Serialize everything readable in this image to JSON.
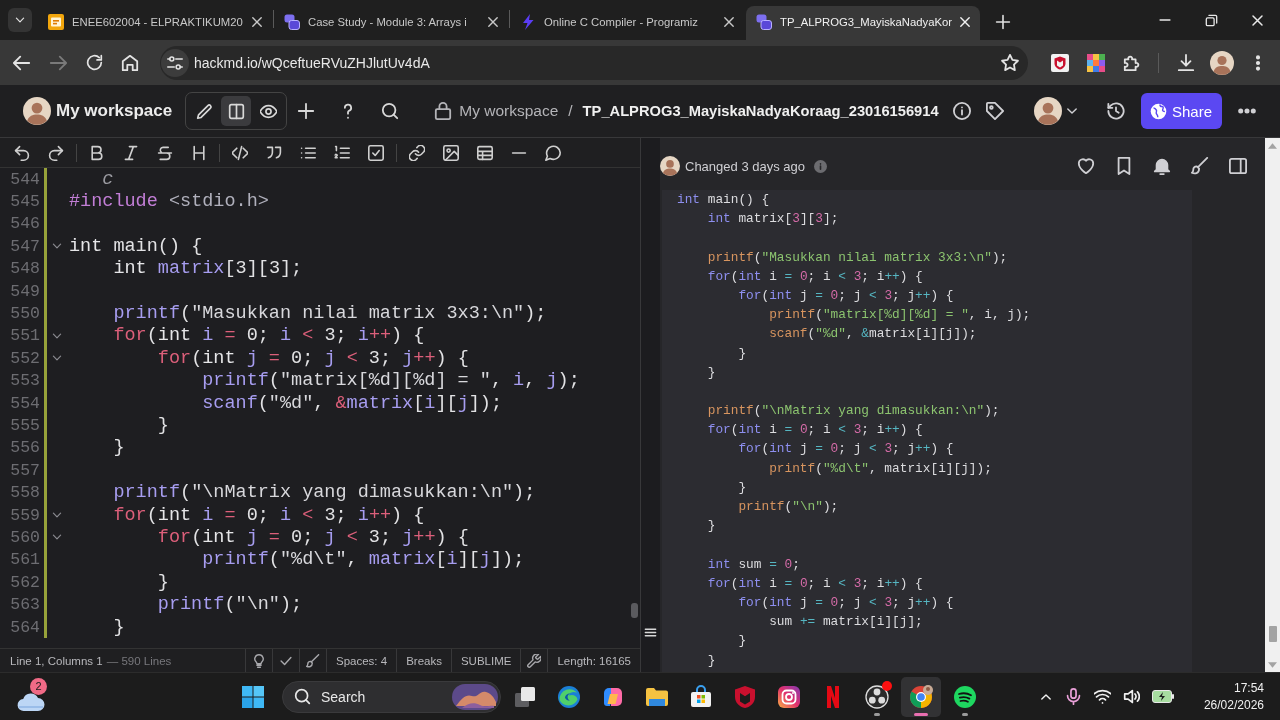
{
  "browser": {
    "tabs": [
      {
        "kind": "docs",
        "title": "ENEE602004 - ELPRAKTIKUM20",
        "selected": false
      },
      {
        "kind": "notes",
        "title": "Case Study - Module 3: Arrays i",
        "selected": false
      },
      {
        "kind": "compiler",
        "title": "Online C Compiler - Programiz",
        "selected": false
      },
      {
        "kind": "notes",
        "title": "TP_ALPROG3_MayiskaNadyaKor",
        "selected": true
      }
    ],
    "url": "hackmd.io/wQceftueRVuZHJlutUv4dA"
  },
  "header": {
    "workspace": "My workspace",
    "modes": [
      {
        "kind": "edit",
        "selected": false
      },
      {
        "kind": "split",
        "selected": true
      },
      {
        "kind": "view",
        "selected": false
      }
    ],
    "breadcrumb": {
      "parent": "My workspace",
      "separator": "/",
      "title": "TP_ALPROG3_MayiskaNadyaKoraag_23016156914"
    },
    "share": "Share"
  },
  "editor": {
    "block_marker": true,
    "lines": [
      {
        "number": "544",
        "kind": "code",
        "fold": false,
        "tokens": [
          {
            "kind": "fence",
            "text": "   c"
          }
        ]
      },
      {
        "number": "545",
        "kind": "code",
        "fold": false,
        "tokens": [
          {
            "kind": "directive",
            "text": "#include"
          },
          {
            "kind": "header",
            "text": " <stdio.h>"
          }
        ]
      },
      {
        "number": "546",
        "kind": "blank",
        "fold": false
      },
      {
        "number": "547",
        "kind": "code",
        "fold": true,
        "tokens": [
          {
            "kind": "type",
            "text": "int"
          },
          {
            "kind": "plain",
            "text": " main() {"
          }
        ]
      },
      {
        "number": "548",
        "kind": "code",
        "fold": false,
        "tokens": [
          {
            "kind": "type",
            "text": "    int"
          },
          {
            "kind": "variable",
            "text": " matrix"
          },
          {
            "kind": "plain",
            "text": "["
          },
          {
            "kind": "number",
            "text": "3"
          },
          {
            "kind": "plain",
            "text": "]["
          },
          {
            "kind": "number",
            "text": "3"
          },
          {
            "kind": "plain",
            "text": "];"
          }
        ]
      },
      {
        "number": "549",
        "kind": "blank",
        "fold": false
      },
      {
        "number": "550",
        "kind": "code",
        "fold": false,
        "tokens": [
          {
            "kind": "function",
            "text": "    printf"
          },
          {
            "kind": "plain",
            "text": "("
          },
          {
            "kind": "string",
            "text": "\"Masukkan nilai matrix 3x3:\\n\""
          },
          {
            "kind": "plain",
            "text": ");"
          }
        ]
      },
      {
        "number": "551",
        "kind": "code",
        "fold": true,
        "tokens": [
          {
            "kind": "keyword",
            "text": "    for"
          },
          {
            "kind": "plain",
            "text": "("
          },
          {
            "kind": "type",
            "text": "int"
          },
          {
            "kind": "variable",
            "text": " i"
          },
          {
            "kind": "operator",
            "text": " ="
          },
          {
            "kind": "number",
            "text": " 0"
          },
          {
            "kind": "plain",
            "text": ";"
          },
          {
            "kind": "variable",
            "text": " i"
          },
          {
            "kind": "operator",
            "text": " <"
          },
          {
            "kind": "number",
            "text": " 3"
          },
          {
            "kind": "plain",
            "text": ";"
          },
          {
            "kind": "variable",
            "text": " i"
          },
          {
            "kind": "operator",
            "text": "++"
          },
          {
            "kind": "plain",
            "text": ") {"
          }
        ]
      },
      {
        "number": "552",
        "kind": "code",
        "fold": true,
        "tokens": [
          {
            "kind": "keyword",
            "text": "        for"
          },
          {
            "kind": "plain",
            "text": "("
          },
          {
            "kind": "type",
            "text": "int"
          },
          {
            "kind": "variable",
            "text": " j"
          },
          {
            "kind": "operator",
            "text": " ="
          },
          {
            "kind": "number",
            "text": " 0"
          },
          {
            "kind": "plain",
            "text": ";"
          },
          {
            "kind": "variable",
            "text": " j"
          },
          {
            "kind": "operator",
            "text": " <"
          },
          {
            "kind": "number",
            "text": " 3"
          },
          {
            "kind": "plain",
            "text": ";"
          },
          {
            "kind": "variable",
            "text": " j"
          },
          {
            "kind": "operator",
            "text": "++"
          },
          {
            "kind": "plain",
            "text": ") {"
          }
        ]
      },
      {
        "number": "553",
        "kind": "code",
        "fold": false,
        "tokens": [
          {
            "kind": "function",
            "text": "            printf"
          },
          {
            "kind": "plain",
            "text": "("
          },
          {
            "kind": "string",
            "text": "\"matrix[%d][%d] = \""
          },
          {
            "kind": "plain",
            "text": ", "
          },
          {
            "kind": "variable",
            "text": "i"
          },
          {
            "kind": "plain",
            "text": ", "
          },
          {
            "kind": "variable",
            "text": "j"
          },
          {
            "kind": "plain",
            "text": ");"
          }
        ]
      },
      {
        "number": "554",
        "kind": "code",
        "fold": false,
        "tokens": [
          {
            "kind": "function",
            "text": "            scanf"
          },
          {
            "kind": "plain",
            "text": "("
          },
          {
            "kind": "string",
            "text": "\"%d\""
          },
          {
            "kind": "plain",
            "text": ", "
          },
          {
            "kind": "operator",
            "text": "&"
          },
          {
            "kind": "variable",
            "text": "matrix"
          },
          {
            "kind": "plain",
            "text": "["
          },
          {
            "kind": "variable",
            "text": "i"
          },
          {
            "kind": "plain",
            "text": "]["
          },
          {
            "kind": "variable",
            "text": "j"
          },
          {
            "kind": "plain",
            "text": "]);"
          }
        ]
      },
      {
        "number": "555",
        "kind": "code",
        "fold": false,
        "tokens": [
          {
            "kind": "plain",
            "text": "        }"
          }
        ]
      },
      {
        "number": "556",
        "kind": "code",
        "fold": false,
        "tokens": [
          {
            "kind": "plain",
            "text": "    }"
          }
        ]
      },
      {
        "number": "557",
        "kind": "blank",
        "fold": false
      },
      {
        "number": "558",
        "kind": "code",
        "fold": false,
        "tokens": [
          {
            "kind": "function",
            "text": "    printf"
          },
          {
            "kind": "plain",
            "text": "("
          },
          {
            "kind": "string",
            "text": "\"\\nMatrix yang dimasukkan:\\n\""
          },
          {
            "kind": "plain",
            "text": ");"
          }
        ]
      },
      {
        "number": "559",
        "kind": "code",
        "fold": true,
        "tokens": [
          {
            "kind": "keyword",
            "text": "    for"
          },
          {
            "kind": "plain",
            "text": "("
          },
          {
            "kind": "type",
            "text": "int"
          },
          {
            "kind": "variable",
            "text": " i"
          },
          {
            "kind": "operator",
            "text": " ="
          },
          {
            "kind": "number",
            "text": " 0"
          },
          {
            "kind": "plain",
            "text": ";"
          },
          {
            "kind": "variable",
            "text": " i"
          },
          {
            "kind": "operator",
            "text": " <"
          },
          {
            "kind": "number",
            "text": " 3"
          },
          {
            "kind": "plain",
            "text": ";"
          },
          {
            "kind": "variable",
            "text": " i"
          },
          {
            "kind": "operator",
            "text": "++"
          },
          {
            "kind": "plain",
            "text": ") {"
          }
        ]
      },
      {
        "number": "560",
        "kind": "code",
        "fold": true,
        "tokens": [
          {
            "kind": "keyword",
            "text": "        for"
          },
          {
            "kind": "plain",
            "text": "("
          },
          {
            "kind": "type",
            "text": "int"
          },
          {
            "kind": "variable",
            "text": " j"
          },
          {
            "kind": "operator",
            "text": " ="
          },
          {
            "kind": "number",
            "text": " 0"
          },
          {
            "kind": "plain",
            "text": ";"
          },
          {
            "kind": "variable",
            "text": " j"
          },
          {
            "kind": "operator",
            "text": " <"
          },
          {
            "kind": "number",
            "text": " 3"
          },
          {
            "kind": "plain",
            "text": ";"
          },
          {
            "kind": "variable",
            "text": " j"
          },
          {
            "kind": "operator",
            "text": "++"
          },
          {
            "kind": "plain",
            "text": ") {"
          }
        ]
      },
      {
        "number": "561",
        "kind": "code",
        "fold": false,
        "tokens": [
          {
            "kind": "function",
            "text": "            printf"
          },
          {
            "kind": "plain",
            "text": "("
          },
          {
            "kind": "string",
            "text": "\"%d\\t\""
          },
          {
            "kind": "plain",
            "text": ", "
          },
          {
            "kind": "variable",
            "text": "matrix"
          },
          {
            "kind": "plain",
            "text": "["
          },
          {
            "kind": "variable",
            "text": "i"
          },
          {
            "kind": "plain",
            "text": "]["
          },
          {
            "kind": "variable",
            "text": "j"
          },
          {
            "kind": "plain",
            "text": "]);"
          }
        ]
      },
      {
        "number": "562",
        "kind": "code",
        "fold": false,
        "tokens": [
          {
            "kind": "plain",
            "text": "        }"
          }
        ]
      },
      {
        "number": "563",
        "kind": "code",
        "fold": false,
        "tokens": [
          {
            "kind": "function",
            "text": "        printf"
          },
          {
            "kind": "plain",
            "text": "("
          },
          {
            "kind": "string",
            "text": "\"\\n\""
          },
          {
            "kind": "plain",
            "text": ");"
          }
        ]
      },
      {
        "number": "564",
        "kind": "code",
        "fold": false,
        "tokens": [
          {
            "kind": "plain",
            "text": "    }"
          }
        ]
      }
    ]
  },
  "status_bar": {
    "position": "Line 1, Columns 1",
    "line_count": "— 590 Lines",
    "indentation": "Spaces: 4",
    "line_breaks": "Breaks",
    "keymap": "SUBLIME",
    "length": "Length: 16165"
  },
  "preview": {
    "changed": "Changed 3 days ago",
    "code_lines": [
      {
        "kind": "code",
        "tokens": [
          {
            "kind": "type",
            "text": "int"
          },
          {
            "kind": "plain",
            "text": " main() {"
          }
        ]
      },
      {
        "kind": "code",
        "tokens": [
          {
            "kind": "type",
            "text": "    int"
          },
          {
            "kind": "variable",
            "text": " matrix"
          },
          {
            "kind": "plain",
            "text": "["
          },
          {
            "kind": "number",
            "text": "3"
          },
          {
            "kind": "plain",
            "text": "]["
          },
          {
            "kind": "number",
            "text": "3"
          },
          {
            "kind": "plain",
            "text": "];"
          }
        ]
      },
      {
        "kind": "blank"
      },
      {
        "kind": "code",
        "tokens": [
          {
            "kind": "function",
            "text": "    printf"
          },
          {
            "kind": "plain",
            "text": "("
          },
          {
            "kind": "string",
            "text": "\"Masukkan nilai matrix 3x3:\\n\""
          },
          {
            "kind": "plain",
            "text": ");"
          }
        ]
      },
      {
        "kind": "code",
        "tokens": [
          {
            "kind": "keyword",
            "text": "    for"
          },
          {
            "kind": "plain",
            "text": "("
          },
          {
            "kind": "type",
            "text": "int"
          },
          {
            "kind": "variable",
            "text": " i"
          },
          {
            "kind": "operator",
            "text": " ="
          },
          {
            "kind": "number",
            "text": " 0"
          },
          {
            "kind": "plain",
            "text": ";"
          },
          {
            "kind": "variable",
            "text": " i"
          },
          {
            "kind": "operator",
            "text": " <"
          },
          {
            "kind": "number",
            "text": " 3"
          },
          {
            "kind": "plain",
            "text": ";"
          },
          {
            "kind": "variable",
            "text": " i"
          },
          {
            "kind": "operator",
            "text": "++"
          },
          {
            "kind": "plain",
            "text": ") {"
          }
        ]
      },
      {
        "kind": "code",
        "tokens": [
          {
            "kind": "keyword",
            "text": "        for"
          },
          {
            "kind": "plain",
            "text": "("
          },
          {
            "kind": "type",
            "text": "int"
          },
          {
            "kind": "variable",
            "text": " j"
          },
          {
            "kind": "operator",
            "text": " ="
          },
          {
            "kind": "number",
            "text": " 0"
          },
          {
            "kind": "plain",
            "text": ";"
          },
          {
            "kind": "variable",
            "text": " j"
          },
          {
            "kind": "operator",
            "text": " <"
          },
          {
            "kind": "number",
            "text": " 3"
          },
          {
            "kind": "plain",
            "text": ";"
          },
          {
            "kind": "variable",
            "text": " j"
          },
          {
            "kind": "operator",
            "text": "++"
          },
          {
            "kind": "plain",
            "text": ") {"
          }
        ]
      },
      {
        "kind": "code",
        "tokens": [
          {
            "kind": "function",
            "text": "            printf"
          },
          {
            "kind": "plain",
            "text": "("
          },
          {
            "kind": "string",
            "text": "\"matrix[%d][%d] = \""
          },
          {
            "kind": "plain",
            "text": ", "
          },
          {
            "kind": "variable",
            "text": "i"
          },
          {
            "kind": "plain",
            "text": ", "
          },
          {
            "kind": "variable",
            "text": "j"
          },
          {
            "kind": "plain",
            "text": ");"
          }
        ]
      },
      {
        "kind": "code",
        "tokens": [
          {
            "kind": "function",
            "text": "            scanf"
          },
          {
            "kind": "plain",
            "text": "("
          },
          {
            "kind": "string",
            "text": "\"%d\""
          },
          {
            "kind": "plain",
            "text": ", "
          },
          {
            "kind": "operator",
            "text": "&"
          },
          {
            "kind": "variable",
            "text": "matrix"
          },
          {
            "kind": "plain",
            "text": "["
          },
          {
            "kind": "variable",
            "text": "i"
          },
          {
            "kind": "plain",
            "text": "]["
          },
          {
            "kind": "variable",
            "text": "j"
          },
          {
            "kind": "plain",
            "text": "]);"
          }
        ]
      },
      {
        "kind": "code",
        "tokens": [
          {
            "kind": "plain",
            "text": "        }"
          }
        ]
      },
      {
        "kind": "code",
        "tokens": [
          {
            "kind": "plain",
            "text": "    }"
          }
        ]
      },
      {
        "kind": "blank"
      },
      {
        "kind": "code",
        "tokens": [
          {
            "kind": "function",
            "text": "    printf"
          },
          {
            "kind": "plain",
            "text": "("
          },
          {
            "kind": "string",
            "text": "\"\\nMatrix yang dimasukkan:\\n\""
          },
          {
            "kind": "plain",
            "text": ");"
          }
        ]
      },
      {
        "kind": "code",
        "tokens": [
          {
            "kind": "keyword",
            "text": "    for"
          },
          {
            "kind": "plain",
            "text": "("
          },
          {
            "kind": "type",
            "text": "int"
          },
          {
            "kind": "variable",
            "text": " i"
          },
          {
            "kind": "operator",
            "text": " ="
          },
          {
            "kind": "number",
            "text": " 0"
          },
          {
            "kind": "plain",
            "text": ";"
          },
          {
            "kind": "variable",
            "text": " i"
          },
          {
            "kind": "operator",
            "text": " <"
          },
          {
            "kind": "number",
            "text": " 3"
          },
          {
            "kind": "plain",
            "text": ";"
          },
          {
            "kind": "variable",
            "text": " i"
          },
          {
            "kind": "operator",
            "text": "++"
          },
          {
            "kind": "plain",
            "text": ") {"
          }
        ]
      },
      {
        "kind": "code",
        "tokens": [
          {
            "kind": "keyword",
            "text": "        for"
          },
          {
            "kind": "plain",
            "text": "("
          },
          {
            "kind": "type",
            "text": "int"
          },
          {
            "kind": "variable",
            "text": " j"
          },
          {
            "kind": "operator",
            "text": " ="
          },
          {
            "kind": "number",
            "text": " 0"
          },
          {
            "kind": "plain",
            "text": ";"
          },
          {
            "kind": "variable",
            "text": " j"
          },
          {
            "kind": "operator",
            "text": " <"
          },
          {
            "kind": "number",
            "text": " 3"
          },
          {
            "kind": "plain",
            "text": ";"
          },
          {
            "kind": "variable",
            "text": " j"
          },
          {
            "kind": "operator",
            "text": "++"
          },
          {
            "kind": "plain",
            "text": ") {"
          }
        ]
      },
      {
        "kind": "code",
        "tokens": [
          {
            "kind": "function",
            "text": "            printf"
          },
          {
            "kind": "plain",
            "text": "("
          },
          {
            "kind": "string",
            "text": "\"%d\\t\""
          },
          {
            "kind": "plain",
            "text": ", "
          },
          {
            "kind": "variable",
            "text": "matrix"
          },
          {
            "kind": "plain",
            "text": "["
          },
          {
            "kind": "variable",
            "text": "i"
          },
          {
            "kind": "plain",
            "text": "]["
          },
          {
            "kind": "variable",
            "text": "j"
          },
          {
            "kind": "plain",
            "text": "]);"
          }
        ]
      },
      {
        "kind": "code",
        "tokens": [
          {
            "kind": "plain",
            "text": "        }"
          }
        ]
      },
      {
        "kind": "code",
        "tokens": [
          {
            "kind": "function",
            "text": "        printf"
          },
          {
            "kind": "plain",
            "text": "("
          },
          {
            "kind": "string",
            "text": "\"\\n\""
          },
          {
            "kind": "plain",
            "text": ");"
          }
        ]
      },
      {
        "kind": "code",
        "tokens": [
          {
            "kind": "plain",
            "text": "    }"
          }
        ]
      },
      {
        "kind": "blank"
      },
      {
        "kind": "code",
        "tokens": [
          {
            "kind": "type",
            "text": "    int"
          },
          {
            "kind": "variable",
            "text": " sum"
          },
          {
            "kind": "operator",
            "text": " ="
          },
          {
            "kind": "number",
            "text": " 0"
          },
          {
            "kind": "plain",
            "text": ";"
          }
        ]
      },
      {
        "kind": "code",
        "tokens": [
          {
            "kind": "keyword",
            "text": "    for"
          },
          {
            "kind": "plain",
            "text": "("
          },
          {
            "kind": "type",
            "text": "int"
          },
          {
            "kind": "variable",
            "text": " i"
          },
          {
            "kind": "operator",
            "text": " ="
          },
          {
            "kind": "number",
            "text": " 0"
          },
          {
            "kind": "plain",
            "text": ";"
          },
          {
            "kind": "variable",
            "text": " i"
          },
          {
            "kind": "operator",
            "text": " <"
          },
          {
            "kind": "number",
            "text": " 3"
          },
          {
            "kind": "plain",
            "text": ";"
          },
          {
            "kind": "variable",
            "text": " i"
          },
          {
            "kind": "operator",
            "text": "++"
          },
          {
            "kind": "plain",
            "text": ") {"
          }
        ]
      },
      {
        "kind": "code",
        "tokens": [
          {
            "kind": "keyword",
            "text": "        for"
          },
          {
            "kind": "plain",
            "text": "("
          },
          {
            "kind": "type",
            "text": "int"
          },
          {
            "kind": "variable",
            "text": " j"
          },
          {
            "kind": "operator",
            "text": " ="
          },
          {
            "kind": "number",
            "text": " 0"
          },
          {
            "kind": "plain",
            "text": ";"
          },
          {
            "kind": "variable",
            "text": " j"
          },
          {
            "kind": "operator",
            "text": " <"
          },
          {
            "kind": "number",
            "text": " 3"
          },
          {
            "kind": "plain",
            "text": ";"
          },
          {
            "kind": "variable",
            "text": " j"
          },
          {
            "kind": "operator",
            "text": "++"
          },
          {
            "kind": "plain",
            "text": ") {"
          }
        ]
      },
      {
        "kind": "code",
        "tokens": [
          {
            "kind": "variable",
            "text": "            sum"
          },
          {
            "kind": "operator",
            "text": " +="
          },
          {
            "kind": "variable",
            "text": " matrix"
          },
          {
            "kind": "plain",
            "text": "["
          },
          {
            "kind": "variable",
            "text": "i"
          },
          {
            "kind": "plain",
            "text": "]["
          },
          {
            "kind": "variable",
            "text": "j"
          },
          {
            "kind": "plain",
            "text": "];"
          }
        ]
      },
      {
        "kind": "code",
        "tokens": [
          {
            "kind": "plain",
            "text": "        }"
          }
        ]
      },
      {
        "kind": "code",
        "tokens": [
          {
            "kind": "plain",
            "text": "    }"
          }
        ]
      }
    ]
  },
  "taskbar": {
    "weather_badge": "2",
    "search": {
      "placeholder": "Search"
    },
    "apps": [
      {
        "kind": "taskview",
        "running": false,
        "selected": false,
        "alert": false
      },
      {
        "kind": "edge",
        "running": false,
        "selected": false,
        "alert": false
      },
      {
        "kind": "copilot",
        "running": false,
        "selected": false,
        "alert": false
      },
      {
        "kind": "files",
        "running": false,
        "selected": false,
        "alert": false
      },
      {
        "kind": "store",
        "running": false,
        "selected": false,
        "alert": false
      },
      {
        "kind": "shield",
        "running": false,
        "selected": false,
        "alert": false
      },
      {
        "kind": "instagram",
        "running": false,
        "selected": false,
        "alert": false
      },
      {
        "kind": "netflix",
        "running": false,
        "selected": false,
        "alert": false
      },
      {
        "kind": "obs",
        "running": true,
        "selected": false,
        "alert": true
      },
      {
        "kind": "chrome",
        "running": true,
        "selected": true,
        "alert": false
      },
      {
        "kind": "spotify",
        "running": true,
        "selected": false,
        "alert": false
      }
    ],
    "time": "17:54",
    "date": "26/02/2026"
  }
}
